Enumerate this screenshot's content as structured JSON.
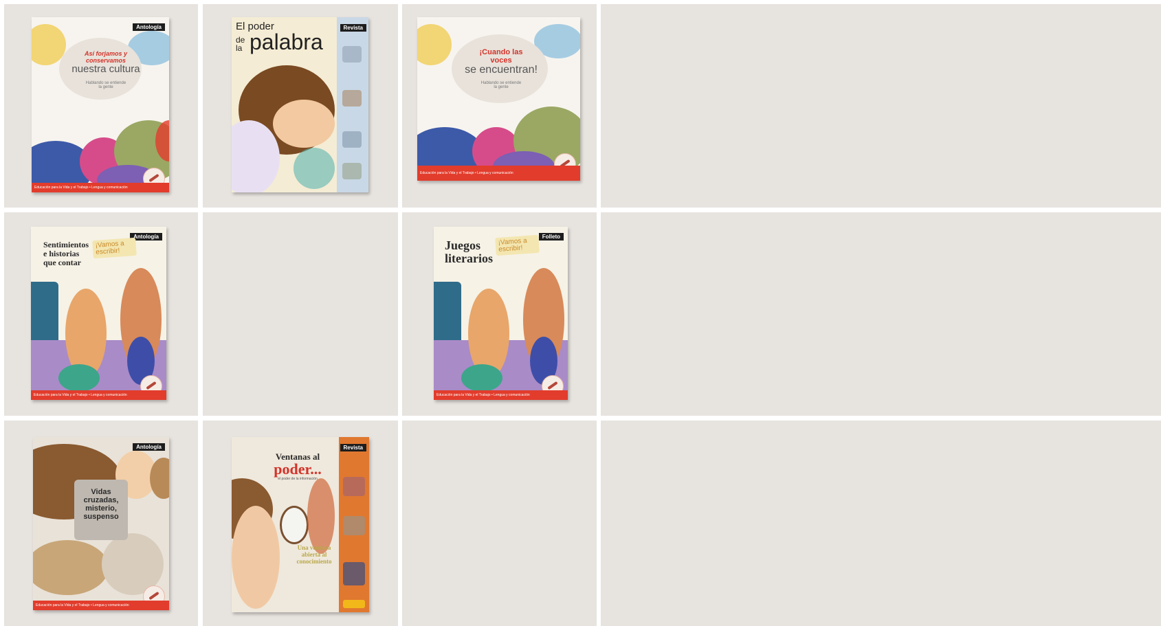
{
  "grid": {
    "background": "#ffffff",
    "cell_color": "#e7e3df"
  },
  "colors": {
    "footer_red": "#e23c2c",
    "title_red": "#d3332a",
    "tag_black": "#1d1d1d"
  },
  "covers": {
    "cultura": {
      "tag": "Antología",
      "title_red": "Así forjamos y conservamos",
      "title_main": "nuestra cultura",
      "subtitle": "Hablando se entiende la gente",
      "footer": "Educación para la Vida y el Trabajo • Lengua y comunicación"
    },
    "palabra": {
      "tag": "Revista",
      "title_small_1": "El poder",
      "title_small_2": "de la",
      "title_big": "palabra"
    },
    "voces": {
      "title_red": "¡Cuando las voces",
      "title_main": "se encuentran!",
      "subtitle": "Hablando se entiende la gente",
      "footer": "Educación para la Vida y el Trabajo • Lengua y comunicación"
    },
    "sentimientos": {
      "tag": "Antología",
      "title": "Sentimientos e historias que contar",
      "badge": "¡Vamos a escribir!",
      "footer": "Educación para la Vida y el Trabajo • Lengua y comunicación"
    },
    "juegos": {
      "tag": "Folleto",
      "title": "Juegos literarios",
      "badge": "¡Vamos a escribir!",
      "footer": "Educación para la Vida y el Trabajo • Lengua y comunicación"
    },
    "vidas": {
      "tag": "Antología",
      "title": "Vidas cruzadas, misterio, suspenso",
      "footer": "Educación para la Vida y el Trabajo • Lengua y comunicación"
    },
    "ventanas": {
      "tag": "Revista",
      "title_small": "Ventanas al",
      "title_big": "poder...",
      "subtitle": "el poder de la información",
      "tagline": "Una ventana abierta al conocimiento"
    }
  }
}
